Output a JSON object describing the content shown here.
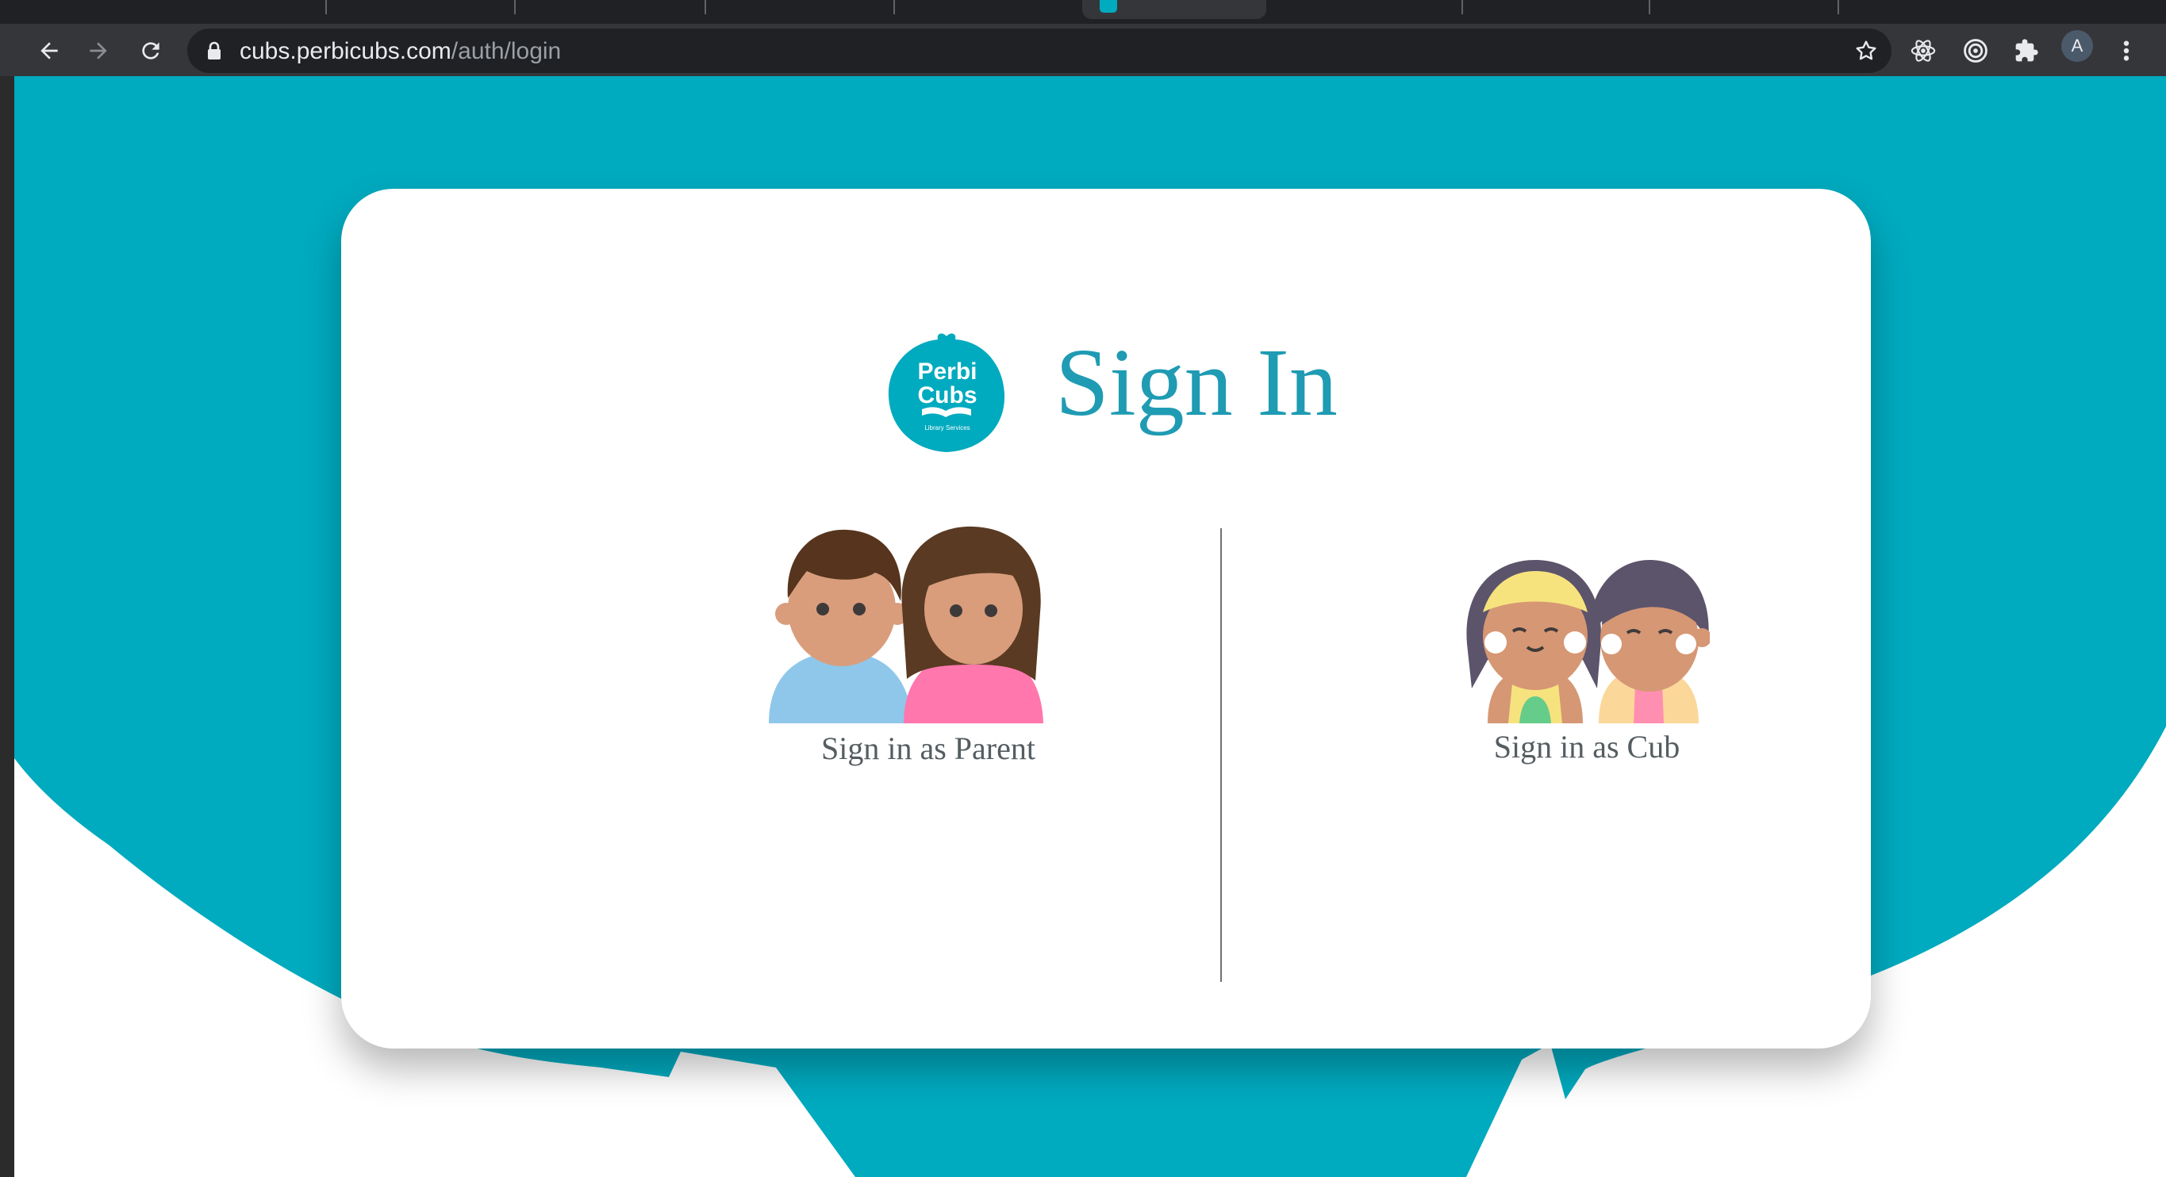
{
  "browser": {
    "url_host": "cubs.perbicubs.com",
    "url_path": "/auth/login",
    "profile_initial": "A"
  },
  "page": {
    "title": "Sign In",
    "logo": {
      "line1": "Perbi",
      "line2": "Cubs",
      "tagline": "Library Services"
    },
    "options": [
      {
        "label": "Sign in as Parent"
      },
      {
        "label": "Sign in as Cub"
      }
    ]
  },
  "colors": {
    "brand_teal": "#00aabf",
    "title_teal": "#1f9bb3",
    "card_bg": "#ffffff"
  }
}
